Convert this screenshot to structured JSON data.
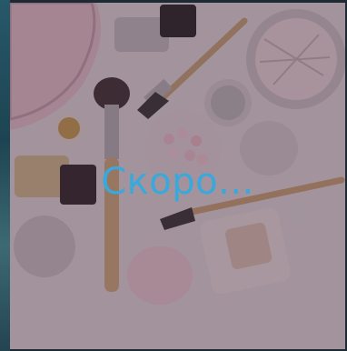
{
  "banner": {
    "status_text": "Скоро...",
    "status_color": "#37a9dc",
    "image_subject": "cosmetics-flatlay"
  }
}
